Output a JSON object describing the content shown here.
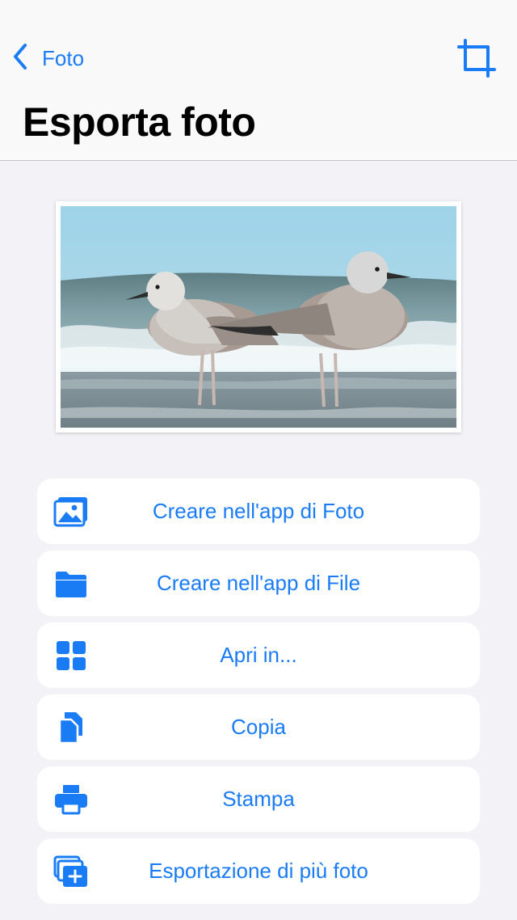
{
  "nav": {
    "back_label": "Foto",
    "title": "Esporta foto"
  },
  "colors": {
    "accent": "#1a7cf4",
    "background": "#f2f2f7",
    "card": "#ffffff"
  },
  "photo": {
    "subject": "two seagulls standing on a beach with waves"
  },
  "actions": [
    {
      "label": "Creare nell'app di Foto",
      "icon": "photo-icon"
    },
    {
      "label": "Creare nell'app di File",
      "icon": "folder-icon"
    },
    {
      "label": "Apri in...",
      "icon": "grid-icon"
    },
    {
      "label": "Copia",
      "icon": "copy-icon"
    },
    {
      "label": "Stampa",
      "icon": "printer-icon"
    },
    {
      "label": "Esportazione di più foto",
      "icon": "multiple-photos-add-icon"
    }
  ]
}
